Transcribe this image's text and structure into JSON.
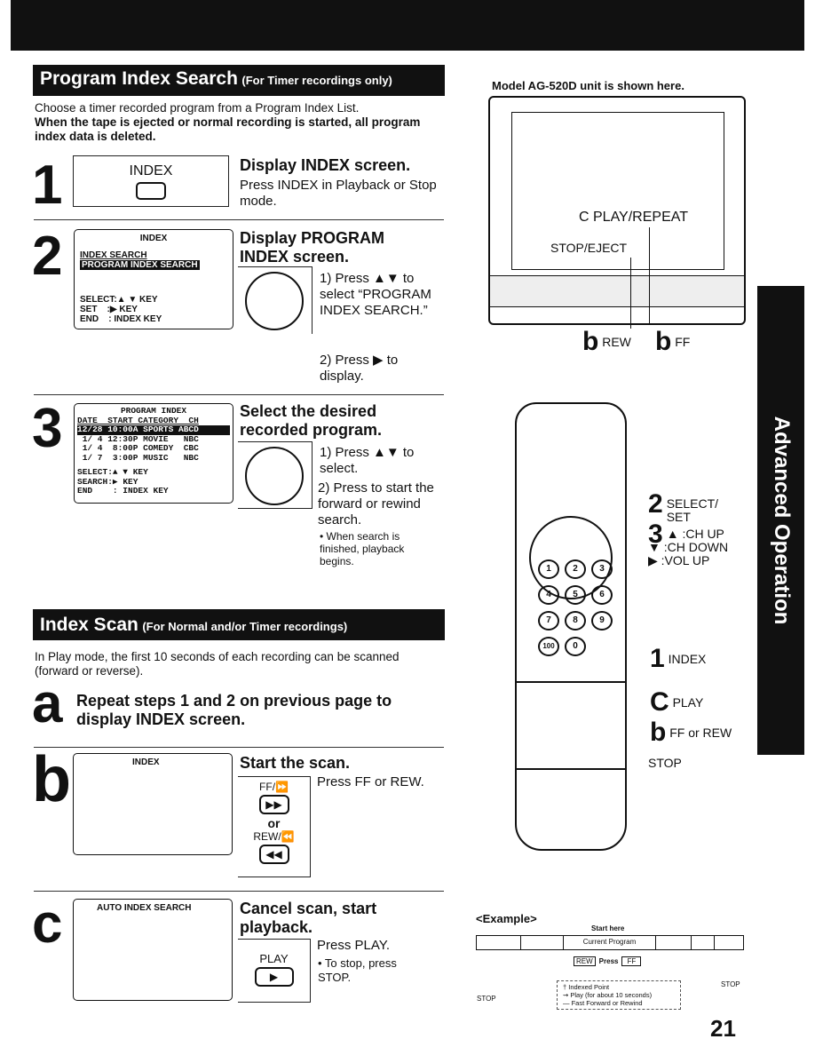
{
  "section1": {
    "title": "Program Index Search",
    "subtitle": "(For Timer recordings only)",
    "intro": "Choose a timer recorded program from a Program Index List.",
    "warning": "When the tape is ejected or normal recording is started, all program index data is deleted."
  },
  "step1": {
    "num": "1",
    "button_label": "INDEX",
    "heading": "Display INDEX screen.",
    "text": "Press INDEX in Playback or Stop mode."
  },
  "step2": {
    "num": "2",
    "screen": {
      "title": "INDEX",
      "line1": "INDEX SEARCH",
      "line2": "PROGRAM INDEX SEARCH",
      "select": "SELECT:▲ ▼ KEY",
      "set": "SET    :▶ KEY",
      "end": "END    : INDEX KEY"
    },
    "heading": "Display PROGRAM INDEX screen.",
    "sub1": "1) Press ▲▼ to select “PROGRAM INDEX SEARCH.”",
    "sub2": "2) Press ▶ to display."
  },
  "step3": {
    "num": "3",
    "screen": {
      "title": "PROGRAM INDEX",
      "header": "DATE  START CATEGORY  CH",
      "rows": [
        "12/28 10:00A SPORTS ABCD",
        " 1/ 4 12:30P MOVIE   NBC",
        " 1/ 4  8:00P COMEDY  CBC",
        " 1/ 7  3:00P MUSIC   NBC"
      ],
      "select": "SELECT:▲ ▼ KEY",
      "search": "SEARCH:▶ KEY",
      "end": "END    : INDEX KEY"
    },
    "heading": "Select the desired recorded program.",
    "sub1": "1) Press ▲▼ to select.",
    "sub2": "2) Press    to start the forward or rewind search.",
    "note": "• When search is finished, playback begins."
  },
  "section2": {
    "title": "Index Scan",
    "subtitle": "(For Normal and/or Timer recordings)",
    "intro": "In Play mode, the first 10 seconds of each recording can be scanned (forward or reverse)."
  },
  "stepa": {
    "letter": "a",
    "text": "Repeat steps 1 and 2 on previous page to display INDEX screen."
  },
  "stepb": {
    "letter": "b",
    "screen_title": "INDEX",
    "heading": "Start the scan.",
    "ff_label": "FF/⏩",
    "or": "or",
    "rew_label": "REW/⏪",
    "text": "Press FF or REW."
  },
  "stepc": {
    "letter": "c",
    "screen_title": "AUTO INDEX SEARCH",
    "heading": "Cancel scan, start playback.",
    "play_label": "PLAY",
    "text": "Press PLAY.",
    "note": "• To stop, press STOP."
  },
  "tv": {
    "caption": "Model AG-520D unit is shown here.",
    "play_repeat": "C PLAY/REPEAT",
    "stop_eject": "STOP/EJECT",
    "rew": "REW",
    "ff": "FF",
    "b": "b"
  },
  "remote": {
    "select_set": "SELECT/ SET",
    "ch_up": ":CH UP",
    "ch_down": ":CH DOWN",
    "vol_up": ":VOL UP",
    "index": "INDEX",
    "play": "PLAY",
    "ff_rew": "FF or REW",
    "stop": "STOP",
    "n1": "1",
    "n2": "2",
    "n3": "3",
    "c": "C",
    "b": "b",
    "keys": [
      "1",
      "2",
      "3",
      "4",
      "5",
      "6",
      "7",
      "8",
      "9",
      "100",
      "0"
    ]
  },
  "example": {
    "title": "<Example>",
    "start_here": "Start here",
    "current": "Current",
    "program": "Program",
    "rew": "REW",
    "press": "Press",
    "ff": "FF",
    "stop_left": "STOP",
    "stop_right": "STOP",
    "legend": [
      "† Indexed Point",
      "⇝ Play (for about 10 seconds)",
      "— Fast Forward or Rewind"
    ]
  },
  "sidetab": "Advanced Operation",
  "page_number": "21"
}
